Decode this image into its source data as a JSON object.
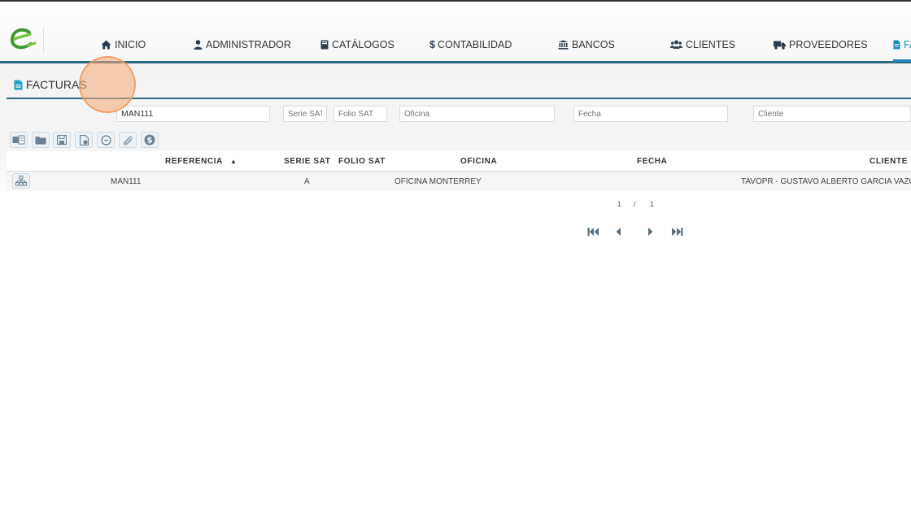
{
  "nav": {
    "items": [
      {
        "label": "INICIO",
        "icon": "home-icon"
      },
      {
        "label": "ADMINISTRADOR",
        "icon": "user-icon"
      },
      {
        "label": "CATÁLOGOS",
        "icon": "book-icon"
      },
      {
        "label": "CONTABILIDAD",
        "icon": "dollar-icon"
      },
      {
        "label": "BANCOS",
        "icon": "bank-icon"
      },
      {
        "label": "CLIENTES",
        "icon": "users-icon"
      },
      {
        "label": "PROVEEDORES",
        "icon": "truck-icon"
      },
      {
        "label": "FA",
        "icon": "file-icon"
      }
    ],
    "active_index": 7,
    "accent_color": "#2a6a86"
  },
  "section": {
    "title": "FACTURAS",
    "icon": "file-icon"
  },
  "filters": {
    "referencia_value": "MAN111",
    "serie_placeholder": "Serie SAT",
    "folio_placeholder": "Folio SAT",
    "oficina_placeholder": "Oficina",
    "fecha_placeholder": "Fecha",
    "cliente_placeholder": "Cliente"
  },
  "toolbar": {
    "buttons": [
      "new-invoice-icon",
      "folder-icon",
      "save-icon",
      "file-check-icon",
      "history-icon",
      "attach-icon",
      "money-icon"
    ]
  },
  "grid": {
    "columns": [
      "REFERENCIA",
      "SERIE SAT",
      "FOLIO SAT",
      "OFICINA",
      "FECHA",
      "CLIENTE"
    ],
    "sort_column": "REFERENCIA",
    "sort_direction": "asc",
    "sort_indicator": "▲",
    "rows": [
      {
        "referencia": "MAN111",
        "serie": "A",
        "folio": "",
        "oficina": "OFICINA MONTERREY",
        "fecha": "",
        "cliente": "TAVOPR - GUSTAVO ALBERTO GARCIA VAZQUE"
      }
    ]
  },
  "pager": {
    "current": "1",
    "separator": "/",
    "total": "1"
  }
}
